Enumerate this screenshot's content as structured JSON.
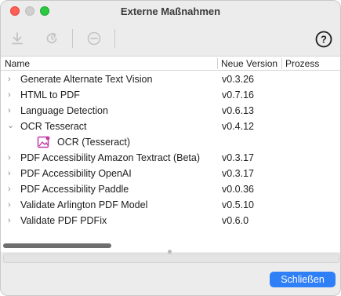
{
  "window": {
    "title": "Externe Maßnahmen"
  },
  "toolbar": {
    "buttons": [
      {
        "icon": "download-icon",
        "enabled": false
      },
      {
        "icon": "refresh-icon",
        "enabled": false
      },
      {
        "icon": "remove-icon",
        "enabled": false
      }
    ],
    "help_label": "?"
  },
  "table": {
    "columns": [
      "Name",
      "Neue Version",
      "Prozess"
    ],
    "rows": [
      {
        "name": "Generate Alternate Text Vision",
        "version": "v0.3.26",
        "expanded": false
      },
      {
        "name": "HTML to PDF",
        "version": "v0.7.16",
        "expanded": false
      },
      {
        "name": "Language Detection",
        "version": "v0.6.13",
        "expanded": false
      },
      {
        "name": "OCR Tesseract",
        "version": "v0.4.12",
        "expanded": true,
        "child": "OCR (Tesseract)"
      },
      {
        "name": "PDF Accessibility Amazon Textract (Beta)",
        "version": "v0.3.17",
        "expanded": false
      },
      {
        "name": "PDF Accessibility OpenAI",
        "version": "v0.3.17",
        "expanded": false
      },
      {
        "name": "PDF Accessibility Paddle",
        "version": "v0.0.36",
        "expanded": false
      },
      {
        "name": "Validate Arlington PDF Model",
        "version": "v0.5.10",
        "expanded": false
      },
      {
        "name": "Validate PDF PDFix",
        "version": "v0.6.0",
        "expanded": false
      }
    ]
  },
  "footer": {
    "close_label": "Schließen"
  },
  "colors": {
    "accent": "#2f7ff6",
    "child_icon": "#c23ca8"
  }
}
